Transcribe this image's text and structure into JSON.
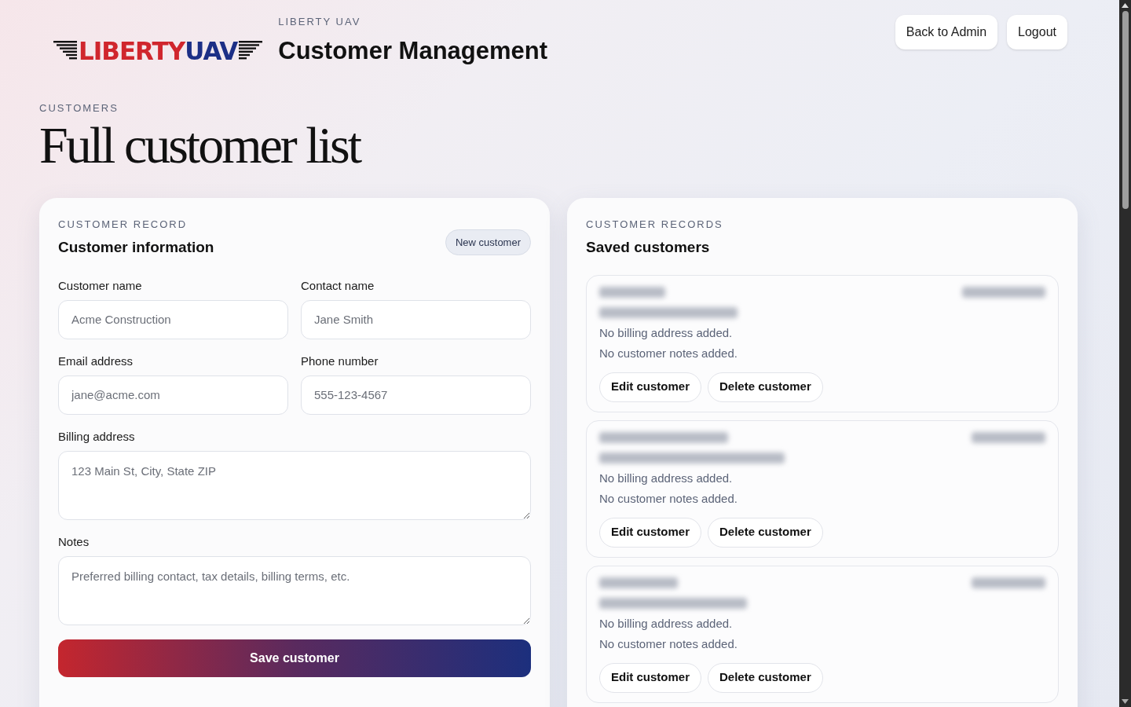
{
  "header": {
    "logo": {
      "part_1": "LIBERTY",
      "part_2": "UAV"
    },
    "eyebrow": "LIBERTY UAV",
    "title": "Customer Management",
    "buttons": [
      "Back to Admin",
      "Logout"
    ]
  },
  "hero": {
    "eyebrow": "CUSTOMERS",
    "title": "Full customer list"
  },
  "form": {
    "eyebrow": "CUSTOMER RECORD",
    "title": "Customer information",
    "badge": "New customer",
    "fields": [
      {
        "kind": "input",
        "label": "Customer name",
        "placeholder": "Acme Construction"
      },
      {
        "kind": "input",
        "label": "Contact name",
        "placeholder": "Jane Smith"
      },
      {
        "kind": "input",
        "label": "Email address",
        "placeholder": "jane@acme.com"
      },
      {
        "kind": "input",
        "label": "Phone number",
        "placeholder": "555-123-4567"
      },
      {
        "kind": "textarea",
        "label": "Billing address",
        "placeholder": "123 Main St, City, State ZIP"
      },
      {
        "kind": "textarea",
        "label": "Notes",
        "placeholder": "Preferred billing contact, tax details, billing terms, etc."
      }
    ],
    "submit": "Save customer"
  },
  "records": {
    "eyebrow": "CUSTOMER RECORDS",
    "title": "Saved customers",
    "items": [
      {
        "billing": "No billing address added.",
        "notes": "No customer notes added.",
        "actions": [
          "Edit customer",
          "Delete customer"
        ]
      },
      {
        "billing": "No billing address added.",
        "notes": "No customer notes added.",
        "actions": [
          "Edit customer",
          "Delete customer"
        ]
      },
      {
        "billing": "No billing address added.",
        "notes": "No customer notes added.",
        "actions": [
          "Edit customer",
          "Delete customer"
        ]
      }
    ]
  }
}
